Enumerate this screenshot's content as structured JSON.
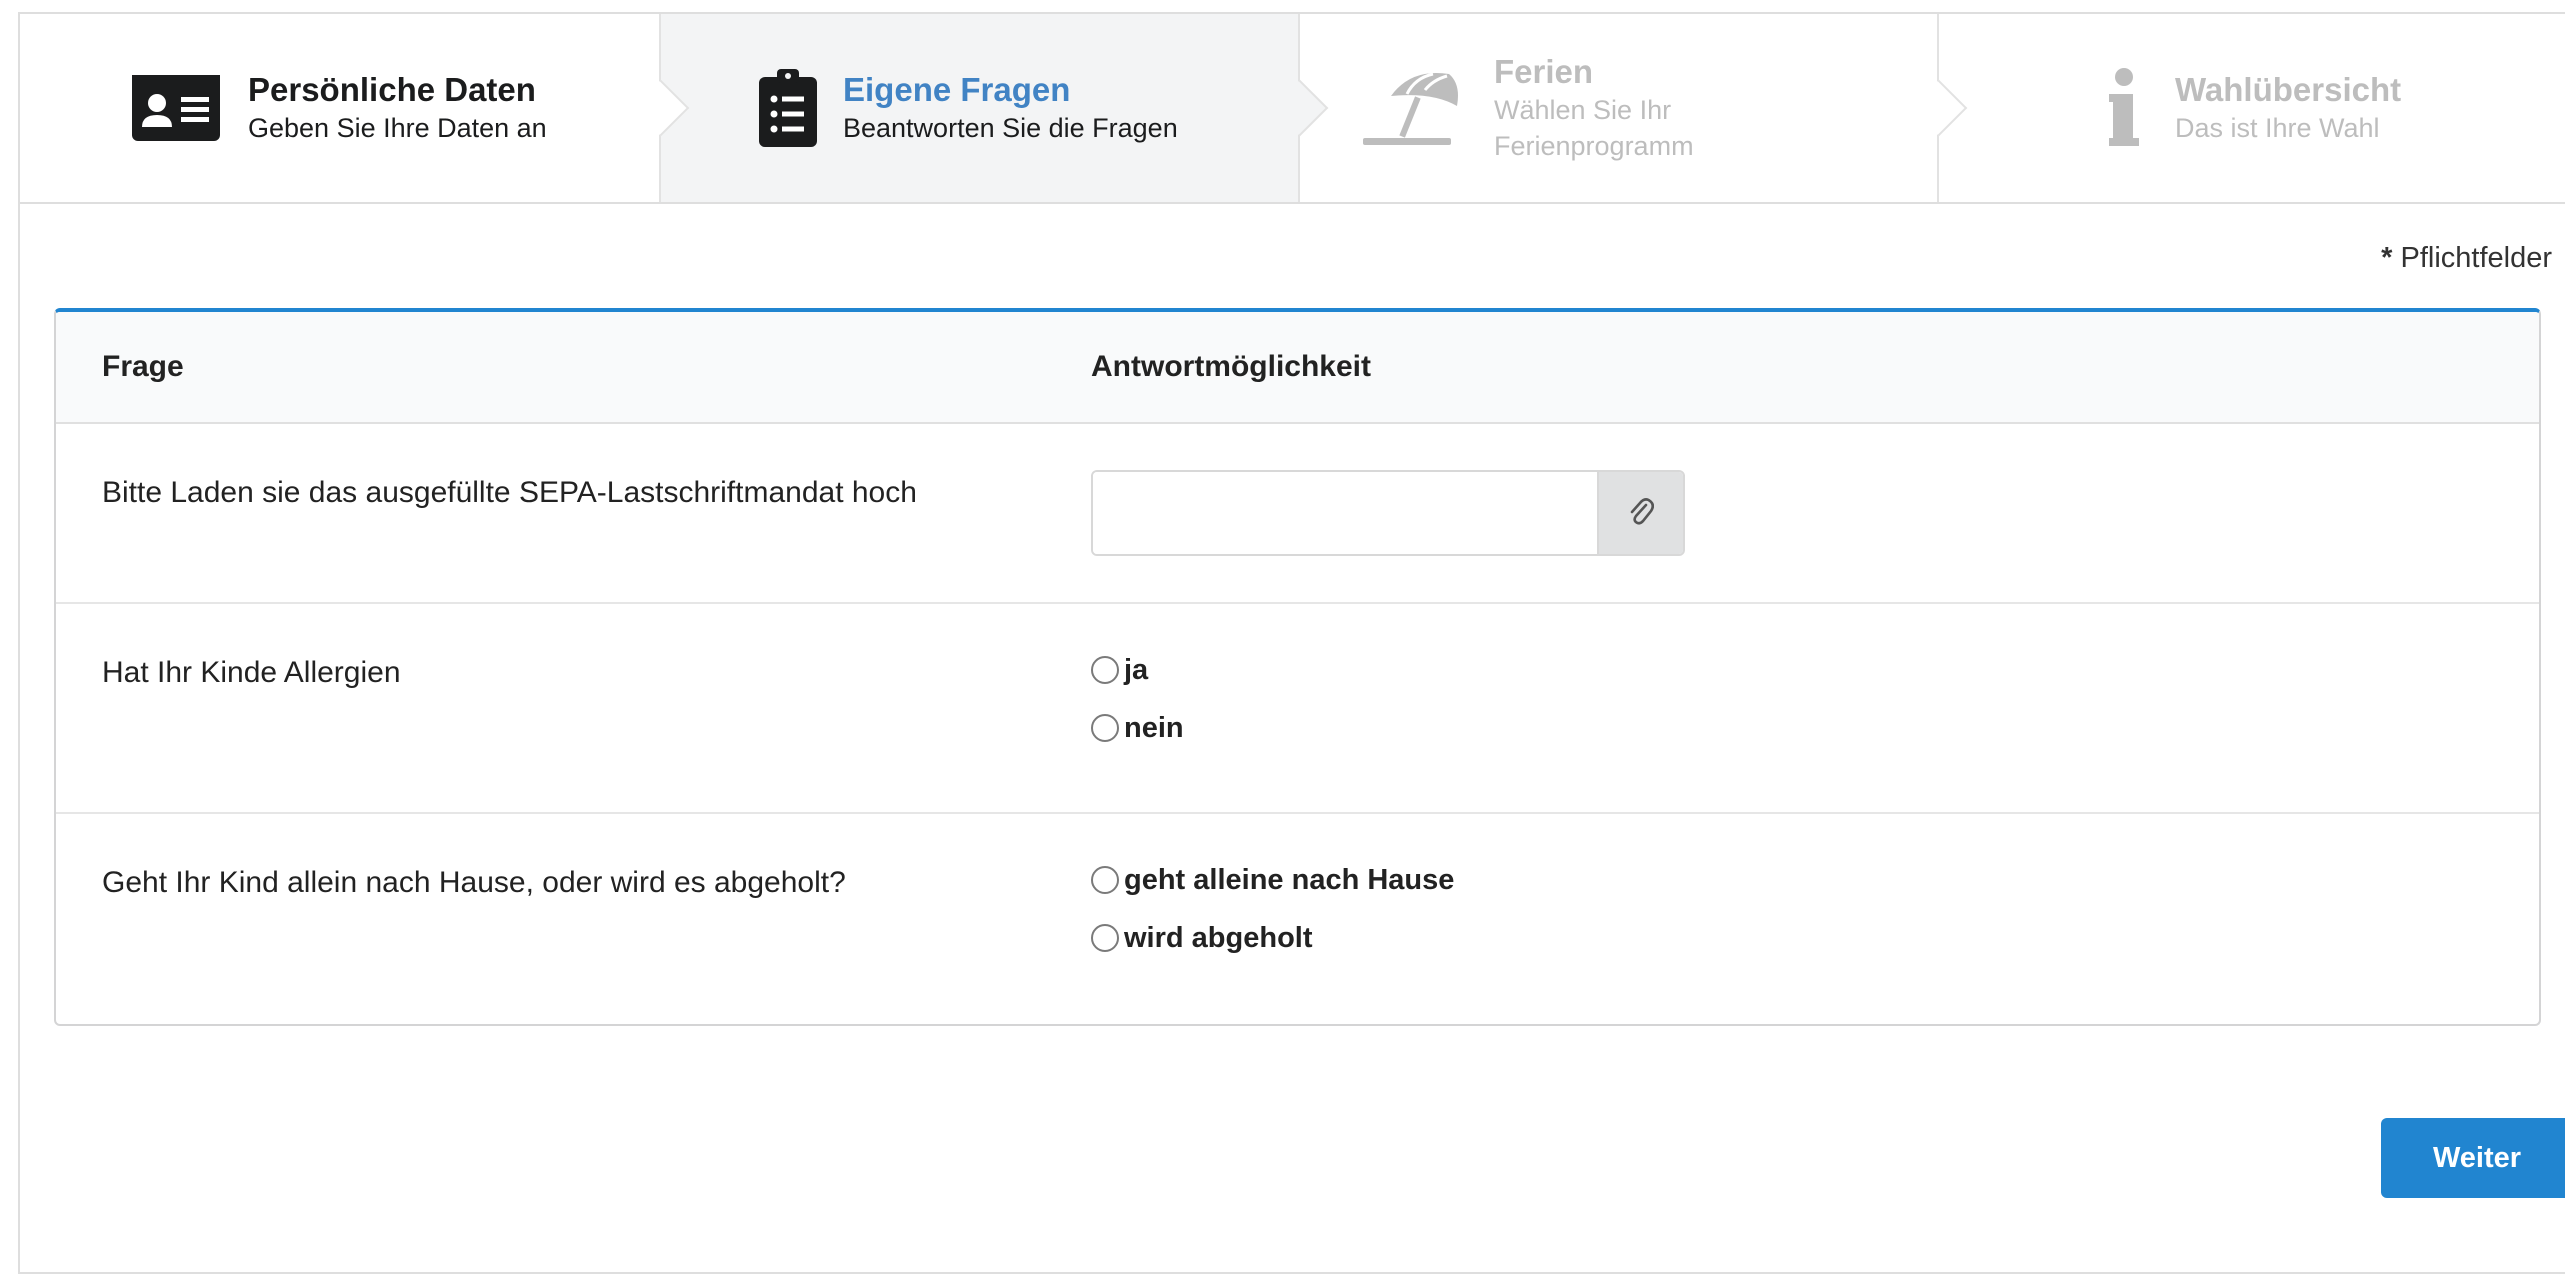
{
  "steps": [
    {
      "title": "Persönliche Daten",
      "desc": "Geben Sie Ihre Daten an",
      "icon": "id-card-icon",
      "state": "completed"
    },
    {
      "title": "Eigene Fragen",
      "desc": "Beantworten Sie die Fragen",
      "icon": "clipboard-list-icon",
      "state": "active"
    },
    {
      "title": "Ferien",
      "desc": "Wählen Sie Ihr Ferienprogramm",
      "icon": "beach-umbrella-icon",
      "state": "disabled"
    },
    {
      "title": "Wahlübersicht",
      "desc": "Das ist Ihre Wahl",
      "icon": "info-icon",
      "state": "disabled"
    }
  ],
  "required_note": {
    "marker": "*",
    "text": " Pflichtfelder"
  },
  "table": {
    "headers": {
      "question": "Frage",
      "answer": "Antwortmöglichkeit"
    },
    "rows": [
      {
        "question": "Bitte Laden sie das ausgefüllte SEPA-Lastschriftmandat hoch",
        "type": "file",
        "icon": "paperclip-icon"
      },
      {
        "question": "Hat Ihr Kinde Allergien",
        "type": "radio",
        "options": [
          "ja",
          "nein"
        ]
      },
      {
        "question": "Geht Ihr Kind allein nach Hause, oder wird es abgeholt?",
        "type": "radio",
        "options": [
          "geht alleine nach Hause",
          "wird abgeholt"
        ]
      }
    ]
  },
  "buttons": {
    "next": "Weiter"
  },
  "colors": {
    "primary": "#2185d0",
    "active_step_title": "#4183c4",
    "disabled_text": "#bdbdbd"
  }
}
